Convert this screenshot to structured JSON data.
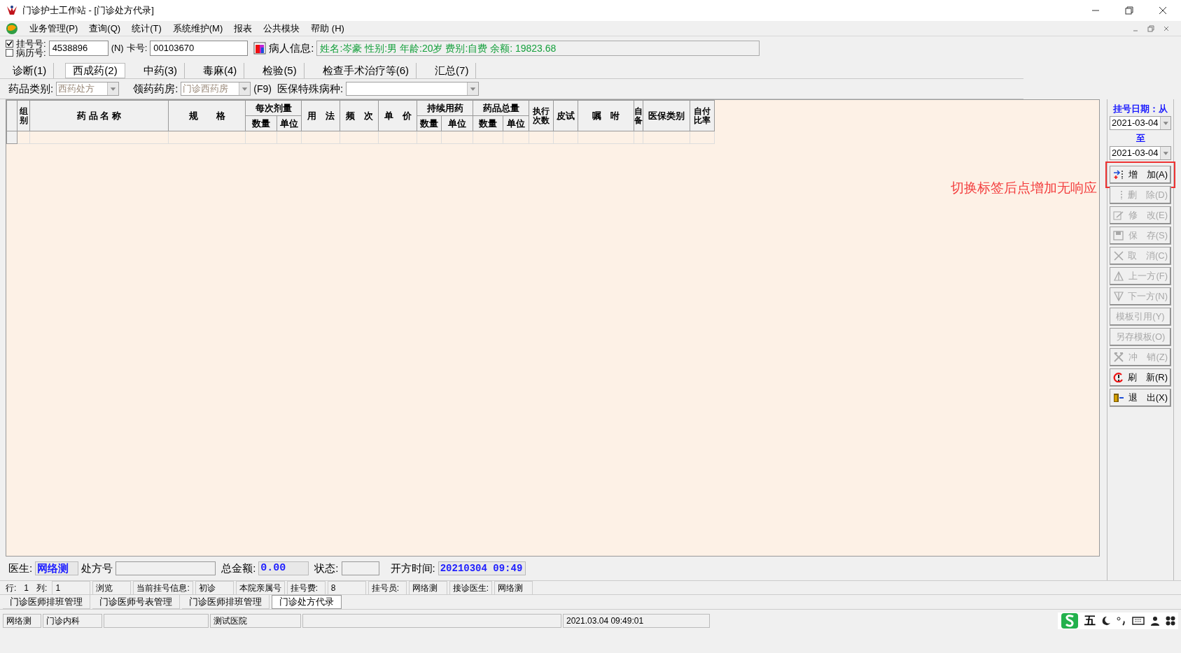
{
  "window": {
    "title": "门诊护士工作站 - [门诊处方代录]"
  },
  "menu": [
    "业务管理(P)",
    "查询(Q)",
    "统计(T)",
    "系统维护(M)",
    "报表",
    "公共模块",
    "帮助 (H)"
  ],
  "patient": {
    "checks": [
      {
        "label": "挂号号:",
        "checked": true
      },
      {
        "label": "病历号:",
        "checked": false
      }
    ],
    "register_no": "4538896",
    "register_hint": "(N)",
    "card_label": "卡号:",
    "card_no": "00103670",
    "info_label": "病人信息:",
    "info": "姓名:岑豪 性别:男 年龄:20岁 费别:自费 余额: 19823.68"
  },
  "tabs": [
    {
      "label": "诊断(1)",
      "selected": false
    },
    {
      "label": "西成药(2)",
      "selected": true
    },
    {
      "label": "中药(3)",
      "selected": false
    },
    {
      "label": "毒麻(4)",
      "selected": false
    },
    {
      "label": "检验(5)",
      "selected": false
    },
    {
      "label": "检查手术治疗等(6)",
      "selected": false
    },
    {
      "label": "汇总(7)",
      "selected": false
    }
  ],
  "filters": {
    "category_label": "药品类别:",
    "category": "西药处方",
    "pharmacy_label": "领药药房:",
    "pharmacy": "门诊西药房",
    "pharmacy_hint": "(F9)",
    "insurance_label": "医保特殊病种:"
  },
  "table": {
    "columns": [
      {
        "label": "组别"
      },
      {
        "label": "药 品 名 称"
      },
      {
        "label": "规　　格"
      },
      {
        "label": "每次剂量",
        "sub": [
          "数量",
          "单位"
        ]
      },
      {
        "label": "用　法"
      },
      {
        "label": "频　次"
      },
      {
        "label": "单　价"
      },
      {
        "label": "持续用药",
        "sub": [
          "数量",
          "单位"
        ]
      },
      {
        "label": "药品总量",
        "sub": [
          "数量",
          "单位"
        ]
      },
      {
        "label": "执行次数"
      },
      {
        "label": "皮试"
      },
      {
        "label": "嘱　咐"
      },
      {
        "label": "自备"
      },
      {
        "label": "医保类别"
      },
      {
        "label": "自付比率"
      }
    ]
  },
  "side": {
    "date_from_label": "挂号日期：从",
    "date_from": "2021-03-04",
    "date_to_label": "至",
    "date_to": "2021-03-04",
    "buttons": [
      {
        "kind": "add",
        "label": "增　加(A)",
        "disabled": false,
        "highlighted": true
      },
      {
        "kind": "delete",
        "label": "删　除(D)",
        "disabled": true,
        "highlighted": false
      },
      {
        "kind": "edit",
        "label": "修　改(E)",
        "disabled": true,
        "highlighted": false
      },
      {
        "kind": "save",
        "label": "保　存(S)",
        "disabled": true,
        "highlighted": false
      },
      {
        "kind": "cancel",
        "label": "取　消(C)",
        "disabled": true,
        "highlighted": false
      },
      {
        "kind": "up",
        "label": "上一方(F)",
        "disabled": true,
        "highlighted": false
      },
      {
        "kind": "down",
        "label": "下一方(N)",
        "disabled": true,
        "highlighted": false
      },
      {
        "kind": "text",
        "label": "模板引用(Y)",
        "disabled": true,
        "highlighted": false
      },
      {
        "kind": "text",
        "label": "另存模板(O)",
        "disabled": true,
        "highlighted": false
      },
      {
        "kind": "reverse",
        "label": "冲　销(Z)",
        "disabled": true,
        "highlighted": false
      },
      {
        "kind": "refresh",
        "label": "刷　新(R)",
        "disabled": false,
        "highlighted": false
      },
      {
        "kind": "exit",
        "label": "退　出(X)",
        "disabled": false,
        "highlighted": false
      }
    ]
  },
  "annotation": "切换标签后点增加无响应",
  "footer": {
    "doctor_label": "医生:",
    "doctor": "网络测",
    "rx_label": "处方号",
    "total_label": "总金额:",
    "total": "0.00",
    "status_label": "状态:",
    "time_label": "开方时间:",
    "time": "20210304 09:49"
  },
  "info_bar": [
    "行:",
    "1",
    "列:",
    "1",
    "浏览",
    "当前挂号信息:",
    "初诊",
    "本院亲属号",
    "挂号费:",
    "8",
    "挂号员:",
    "网络测",
    "接诊医生:",
    "网络测"
  ],
  "window_tabs": [
    {
      "label": "门诊医师排班管理",
      "selected": false
    },
    {
      "label": "门诊医师号表管理",
      "selected": false
    },
    {
      "label": "门诊医师排班管理",
      "selected": false
    },
    {
      "label": "门诊处方代录",
      "selected": true
    }
  ],
  "status_bar": [
    {
      "kind": "text",
      "text": "网络测"
    },
    {
      "kind": "text",
      "text": "门诊内科"
    },
    {
      "kind": "blank"
    },
    {
      "kind": "text",
      "text": "测试医院"
    },
    {
      "kind": "blank"
    },
    {
      "kind": "text",
      "text": "2021.03.04 09:49:01"
    }
  ],
  "ime": {
    "mode": "五"
  }
}
